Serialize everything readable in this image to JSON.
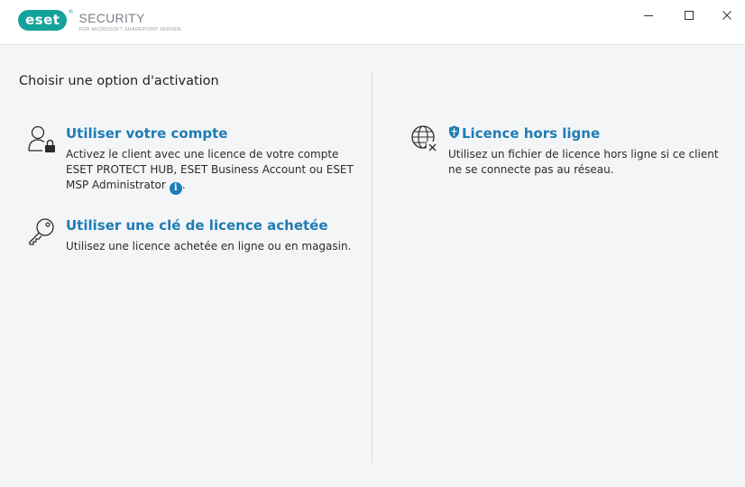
{
  "titlebar": {
    "brand": "eset",
    "product_title": "SECURITY",
    "product_subtitle": "FOR MICROSOFT SHAREPOINT SERVER"
  },
  "heading": "Choisir une option d'activation",
  "options": {
    "account": {
      "icon": "user-lock-icon",
      "title": "Utiliser votre compte",
      "description": "Activez le client avec une licence de votre compte ESET PROTECT HUB, ESET Business Account ou ESET MSP Administrator",
      "description_end": ".",
      "info_icon": "info-icon"
    },
    "license_key": {
      "icon": "key-icon",
      "title": "Utiliser une clé de licence achetée",
      "description": "Utilisez une licence achetée en ligne ou en magasin."
    },
    "offline": {
      "icon": "globe-x-icon",
      "badge_icon": "shield-icon",
      "title": "Licence hors ligne",
      "description": "Utilisez un fichier de licence hors ligne si ce client ne se connecte pas au réseau."
    }
  },
  "colors": {
    "brand": "#13a39a",
    "link": "#1e7cb4",
    "background": "#f4f5f7"
  }
}
